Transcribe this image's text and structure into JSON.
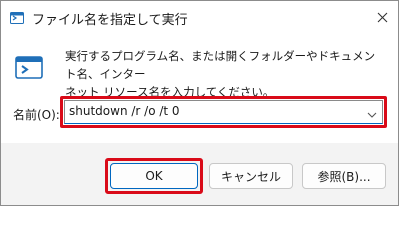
{
  "window": {
    "title": "ファイル名を指定して実行",
    "title_icon": "run-icon",
    "close_icon": "close-icon"
  },
  "content": {
    "icon": "run-dialog-icon",
    "description_line1": "実行するプログラム名、または開くフォルダーやドキュメント名、インター",
    "description_line2": "ネット リソース名を入力してください。",
    "name_label": "名前(O):",
    "name_value": "shutdown /r /o /t 0"
  },
  "buttons": {
    "ok": "OK",
    "cancel": "キャンセル",
    "browse": "参照(B)..."
  },
  "colors": {
    "highlight": "#d90a18",
    "accent": "#0067c0"
  }
}
